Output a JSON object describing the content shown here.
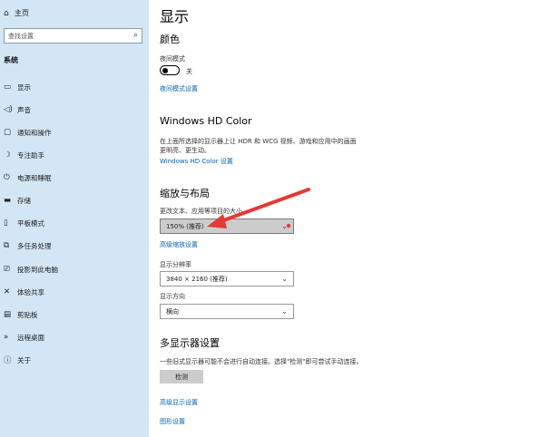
{
  "sidebar": {
    "home_label": "主页",
    "search_placeholder": "查找设置",
    "section_label": "系统",
    "items": [
      {
        "label": "显示"
      },
      {
        "label": "声音"
      },
      {
        "label": "通知和操作"
      },
      {
        "label": "专注助手"
      },
      {
        "label": "电源和睡眠"
      },
      {
        "label": "存储"
      },
      {
        "label": "平板模式"
      },
      {
        "label": "多任务处理"
      },
      {
        "label": "投影到此电脑"
      },
      {
        "label": "体验共享"
      },
      {
        "label": "剪贴板"
      },
      {
        "label": "远程桌面"
      },
      {
        "label": "关于"
      }
    ]
  },
  "main": {
    "title": "显示",
    "color": {
      "heading": "颜色",
      "night_light_label": "夜间模式",
      "toggle_state": "关",
      "night_light_link": "夜间模式设置"
    },
    "hdr": {
      "heading": "Windows HD Color",
      "description_line1": "在上面所选择的显示器上让 HDR 和 WCG 视频、游戏和应用中的画面",
      "description_line2": "更明亮、更生动。",
      "link": "Windows HD Color 设置"
    },
    "scale": {
      "heading": "缩放与布局",
      "scale_label": "更改文本、应用等项目的大小",
      "scale_value": "150% (推荐)",
      "advanced_link": "高级缩放设置",
      "resolution_label": "显示分辨率",
      "resolution_value": "3840 × 2160 (推荐)",
      "orientation_label": "显示方向",
      "orientation_value": "横向"
    },
    "multi": {
      "heading": "多显示器设置",
      "description": "一些旧式显示器可能不会进行自动连接。选择\"检测\"即可尝试手动连接。",
      "detect_button": "检测",
      "advanced_link": "高级显示设置",
      "graphics_link": "图形设置"
    }
  },
  "colors": {
    "sidebar_bg": "#d3e6f5",
    "link": "#0063b1",
    "annotation_arrow": "#e53935"
  }
}
